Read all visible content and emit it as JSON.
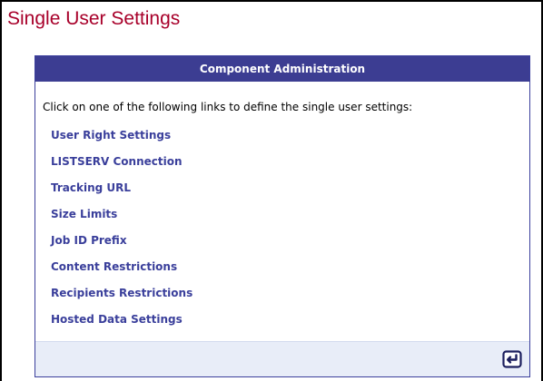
{
  "page": {
    "title": "Single User Settings"
  },
  "panel": {
    "header": "Component Administration",
    "instructions": "Click on one of the following links to define the single user settings:",
    "links": [
      "User Right Settings",
      "LISTSERV Connection",
      "Tracking URL",
      "Size Limits",
      "Job ID Prefix",
      "Content Restrictions",
      "Recipients Restrictions",
      "Hosted Data Settings"
    ],
    "footer": {
      "back_icon": "return-arrow-icon"
    }
  },
  "colors": {
    "title": "#a8002a",
    "header_background": "#3c3d92",
    "link": "#3a3f9b",
    "footer_background": "#e8edf8"
  }
}
